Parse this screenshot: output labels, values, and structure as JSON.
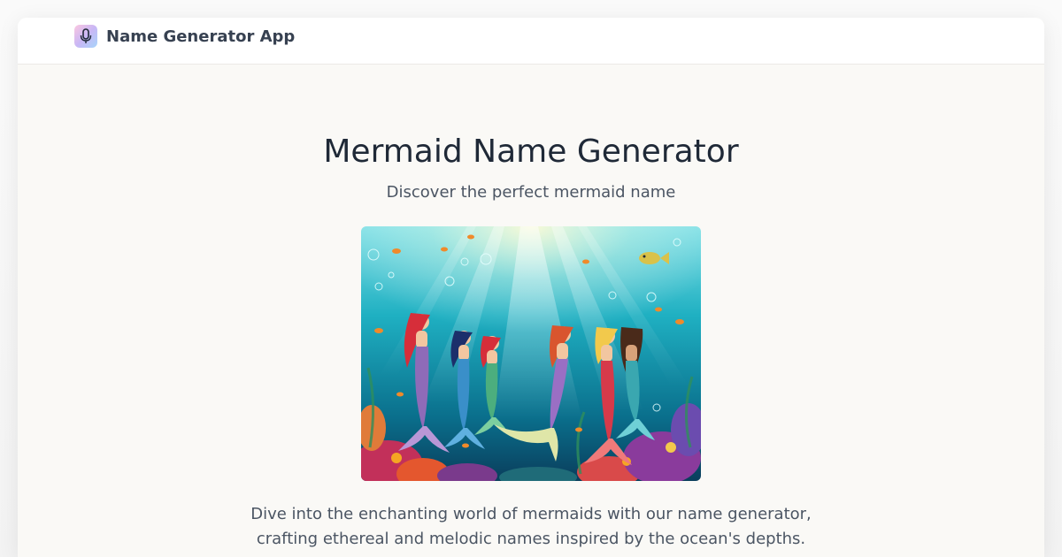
{
  "navbar": {
    "brand_name": "Name Generator App",
    "brand_icon": "microphone-icon"
  },
  "hero": {
    "title": "Mermaid Name Generator",
    "subtitle": "Discover the perfect mermaid name",
    "image_icon": "mermaids-underwater-illustration"
  },
  "description": {
    "line1": "Dive into the enchanting world of mermaids with our name generator,",
    "line2": "crafting ethereal and melodic names inspired by the ocean's depths."
  },
  "colors": {
    "page_background": "#faf9f6",
    "navbar_background": "#ffffff",
    "title_text": "#1f2937",
    "body_text": "#4b5563"
  }
}
